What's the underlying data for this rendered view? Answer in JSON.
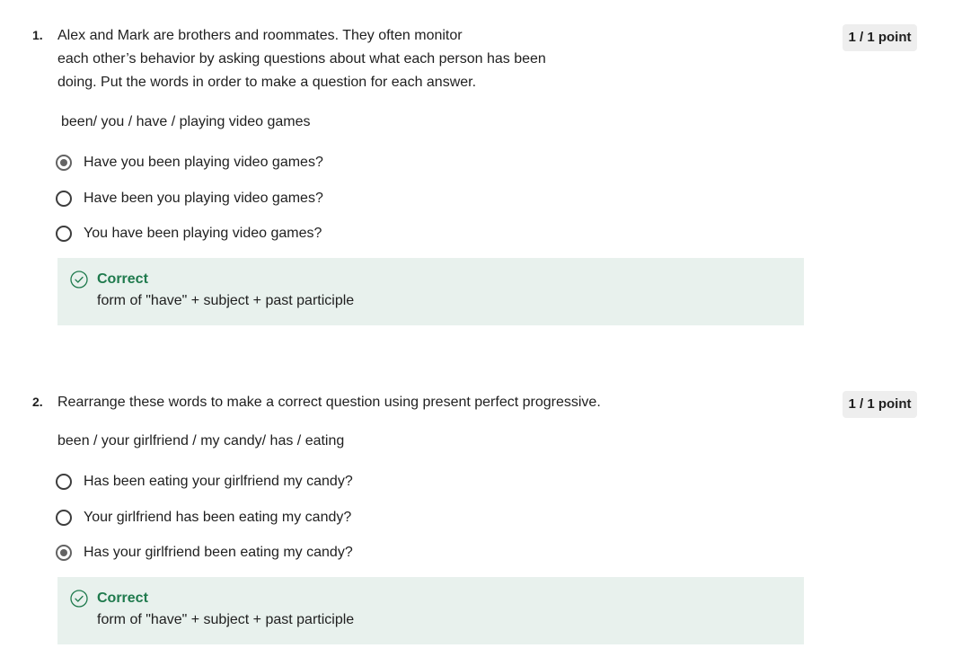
{
  "questions": [
    {
      "number": "1.",
      "prompt": "Alex and Mark are brothers and roommates. They often monitor\neach other’s behavior by asking questions about what each person has been\ndoing. Put the words in order to make a question for each answer.",
      "points": "1 / 1 point",
      "words": "been/ you / have / playing video games",
      "options": [
        {
          "label": "Have you been playing video games?",
          "selected": true
        },
        {
          "label": "Have been you playing video games?",
          "selected": false
        },
        {
          "label": "You have been playing video games?",
          "selected": false
        }
      ],
      "feedback": {
        "title": "Correct",
        "text": "form of \"have\" + subject + past participle",
        "icon": "check-circle-icon",
        "color": "#1f7a4d"
      }
    },
    {
      "number": "2.",
      "prompt": "Rearrange these words to make a correct question using present perfect progressive.",
      "points": "1 / 1 point",
      "words": "been / your girlfriend / my candy/ has / eating",
      "options": [
        {
          "label": "Has been eating your girlfriend my candy?",
          "selected": false
        },
        {
          "label": "Your girlfriend has been eating my candy?",
          "selected": false
        },
        {
          "label": "Has your girlfriend been eating my candy?",
          "selected": true
        }
      ],
      "feedback": {
        "title": "Correct",
        "text": "form of \"have\" + subject + past participle",
        "icon": "check-circle-icon",
        "color": "#1f7a4d"
      }
    }
  ]
}
